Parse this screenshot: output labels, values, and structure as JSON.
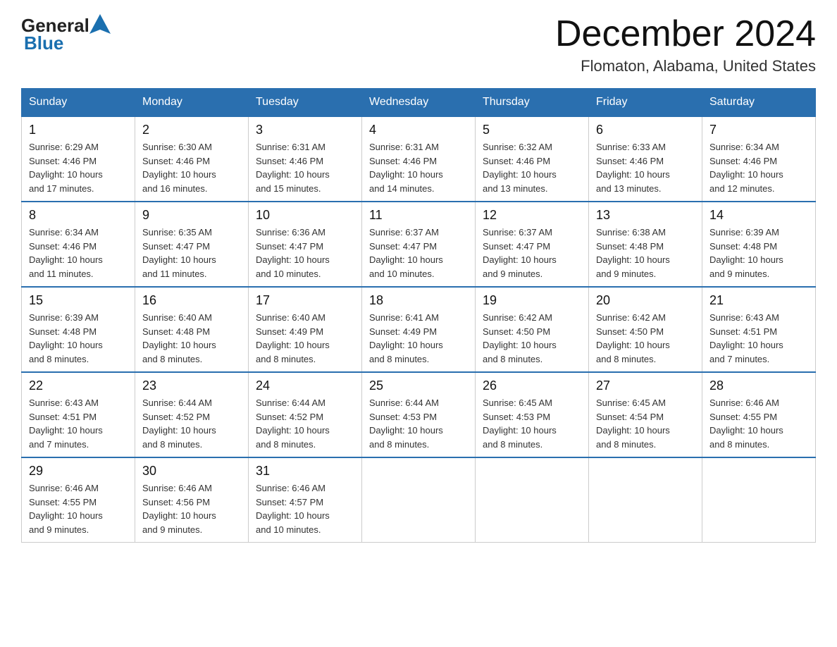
{
  "header": {
    "logo": {
      "general_text": "General",
      "blue_text": "Blue"
    },
    "title": "December 2024",
    "location": "Flomaton, Alabama, United States"
  },
  "weekdays": [
    "Sunday",
    "Monday",
    "Tuesday",
    "Wednesday",
    "Thursday",
    "Friday",
    "Saturday"
  ],
  "weeks": [
    [
      {
        "day": "1",
        "sunrise": "6:29 AM",
        "sunset": "4:46 PM",
        "daylight": "10 hours and 17 minutes."
      },
      {
        "day": "2",
        "sunrise": "6:30 AM",
        "sunset": "4:46 PM",
        "daylight": "10 hours and 16 minutes."
      },
      {
        "day": "3",
        "sunrise": "6:31 AM",
        "sunset": "4:46 PM",
        "daylight": "10 hours and 15 minutes."
      },
      {
        "day": "4",
        "sunrise": "6:31 AM",
        "sunset": "4:46 PM",
        "daylight": "10 hours and 14 minutes."
      },
      {
        "day": "5",
        "sunrise": "6:32 AM",
        "sunset": "4:46 PM",
        "daylight": "10 hours and 13 minutes."
      },
      {
        "day": "6",
        "sunrise": "6:33 AM",
        "sunset": "4:46 PM",
        "daylight": "10 hours and 13 minutes."
      },
      {
        "day": "7",
        "sunrise": "6:34 AM",
        "sunset": "4:46 PM",
        "daylight": "10 hours and 12 minutes."
      }
    ],
    [
      {
        "day": "8",
        "sunrise": "6:34 AM",
        "sunset": "4:46 PM",
        "daylight": "10 hours and 11 minutes."
      },
      {
        "day": "9",
        "sunrise": "6:35 AM",
        "sunset": "4:47 PM",
        "daylight": "10 hours and 11 minutes."
      },
      {
        "day": "10",
        "sunrise": "6:36 AM",
        "sunset": "4:47 PM",
        "daylight": "10 hours and 10 minutes."
      },
      {
        "day": "11",
        "sunrise": "6:37 AM",
        "sunset": "4:47 PM",
        "daylight": "10 hours and 10 minutes."
      },
      {
        "day": "12",
        "sunrise": "6:37 AM",
        "sunset": "4:47 PM",
        "daylight": "10 hours and 9 minutes."
      },
      {
        "day": "13",
        "sunrise": "6:38 AM",
        "sunset": "4:48 PM",
        "daylight": "10 hours and 9 minutes."
      },
      {
        "day": "14",
        "sunrise": "6:39 AM",
        "sunset": "4:48 PM",
        "daylight": "10 hours and 9 minutes."
      }
    ],
    [
      {
        "day": "15",
        "sunrise": "6:39 AM",
        "sunset": "4:48 PM",
        "daylight": "10 hours and 8 minutes."
      },
      {
        "day": "16",
        "sunrise": "6:40 AM",
        "sunset": "4:48 PM",
        "daylight": "10 hours and 8 minutes."
      },
      {
        "day": "17",
        "sunrise": "6:40 AM",
        "sunset": "4:49 PM",
        "daylight": "10 hours and 8 minutes."
      },
      {
        "day": "18",
        "sunrise": "6:41 AM",
        "sunset": "4:49 PM",
        "daylight": "10 hours and 8 minutes."
      },
      {
        "day": "19",
        "sunrise": "6:42 AM",
        "sunset": "4:50 PM",
        "daylight": "10 hours and 8 minutes."
      },
      {
        "day": "20",
        "sunrise": "6:42 AM",
        "sunset": "4:50 PM",
        "daylight": "10 hours and 8 minutes."
      },
      {
        "day": "21",
        "sunrise": "6:43 AM",
        "sunset": "4:51 PM",
        "daylight": "10 hours and 7 minutes."
      }
    ],
    [
      {
        "day": "22",
        "sunrise": "6:43 AM",
        "sunset": "4:51 PM",
        "daylight": "10 hours and 7 minutes."
      },
      {
        "day": "23",
        "sunrise": "6:44 AM",
        "sunset": "4:52 PM",
        "daylight": "10 hours and 8 minutes."
      },
      {
        "day": "24",
        "sunrise": "6:44 AM",
        "sunset": "4:52 PM",
        "daylight": "10 hours and 8 minutes."
      },
      {
        "day": "25",
        "sunrise": "6:44 AM",
        "sunset": "4:53 PM",
        "daylight": "10 hours and 8 minutes."
      },
      {
        "day": "26",
        "sunrise": "6:45 AM",
        "sunset": "4:53 PM",
        "daylight": "10 hours and 8 minutes."
      },
      {
        "day": "27",
        "sunrise": "6:45 AM",
        "sunset": "4:54 PM",
        "daylight": "10 hours and 8 minutes."
      },
      {
        "day": "28",
        "sunrise": "6:46 AM",
        "sunset": "4:55 PM",
        "daylight": "10 hours and 8 minutes."
      }
    ],
    [
      {
        "day": "29",
        "sunrise": "6:46 AM",
        "sunset": "4:55 PM",
        "daylight": "10 hours and 9 minutes."
      },
      {
        "day": "30",
        "sunrise": "6:46 AM",
        "sunset": "4:56 PM",
        "daylight": "10 hours and 9 minutes."
      },
      {
        "day": "31",
        "sunrise": "6:46 AM",
        "sunset": "4:57 PM",
        "daylight": "10 hours and 10 minutes."
      },
      null,
      null,
      null,
      null
    ]
  ],
  "labels": {
    "sunrise": "Sunrise:",
    "sunset": "Sunset:",
    "daylight": "Daylight:"
  }
}
